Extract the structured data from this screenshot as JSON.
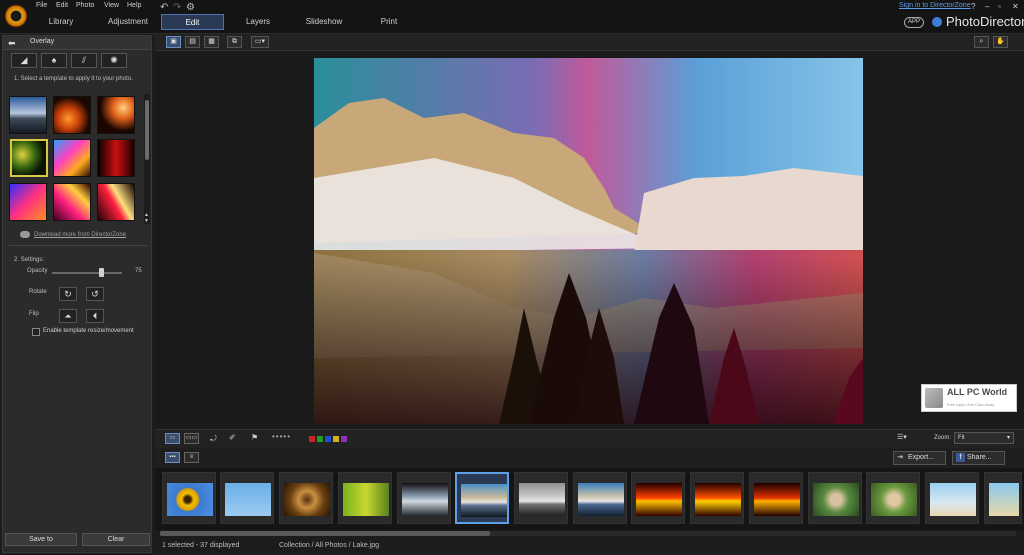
{
  "menu": [
    "File",
    "Edit",
    "Photo",
    "View",
    "Help"
  ],
  "tabs": [
    "Library",
    "Adjustment",
    "Edit",
    "Layers",
    "Slideshow",
    "Print"
  ],
  "signin": "Sign in to DirectorZone",
  "app_badge": "APP",
  "app_title": "PhotoDirector",
  "panel": {
    "title": "Overlay",
    "step1": "1. Select a template to apply it to your photo.",
    "download": "Download more from DirectorZone",
    "step2": "2. Settings:",
    "opacity_label": "Opacity",
    "opacity_value": "75",
    "opacity_level": 0.78,
    "rotate_label": "Rotate",
    "flip_label": "Flip",
    "enable_label": "Enable template resize/movement",
    "save": "Save to",
    "clear": "Clear"
  },
  "zoom": {
    "label": "Zoom:",
    "value": "Fit"
  },
  "export": "Export...",
  "share": "Share...",
  "status": {
    "count": "1 selected - 37 displayed",
    "path": "Collection / All Photos / Lake.jpg"
  },
  "watermark": {
    "title": "ALL PC World",
    "sub": "Free Apps One Click Away"
  },
  "colors": {
    "accent": "#5da0e8",
    "tab_active": "#2a3a55"
  }
}
